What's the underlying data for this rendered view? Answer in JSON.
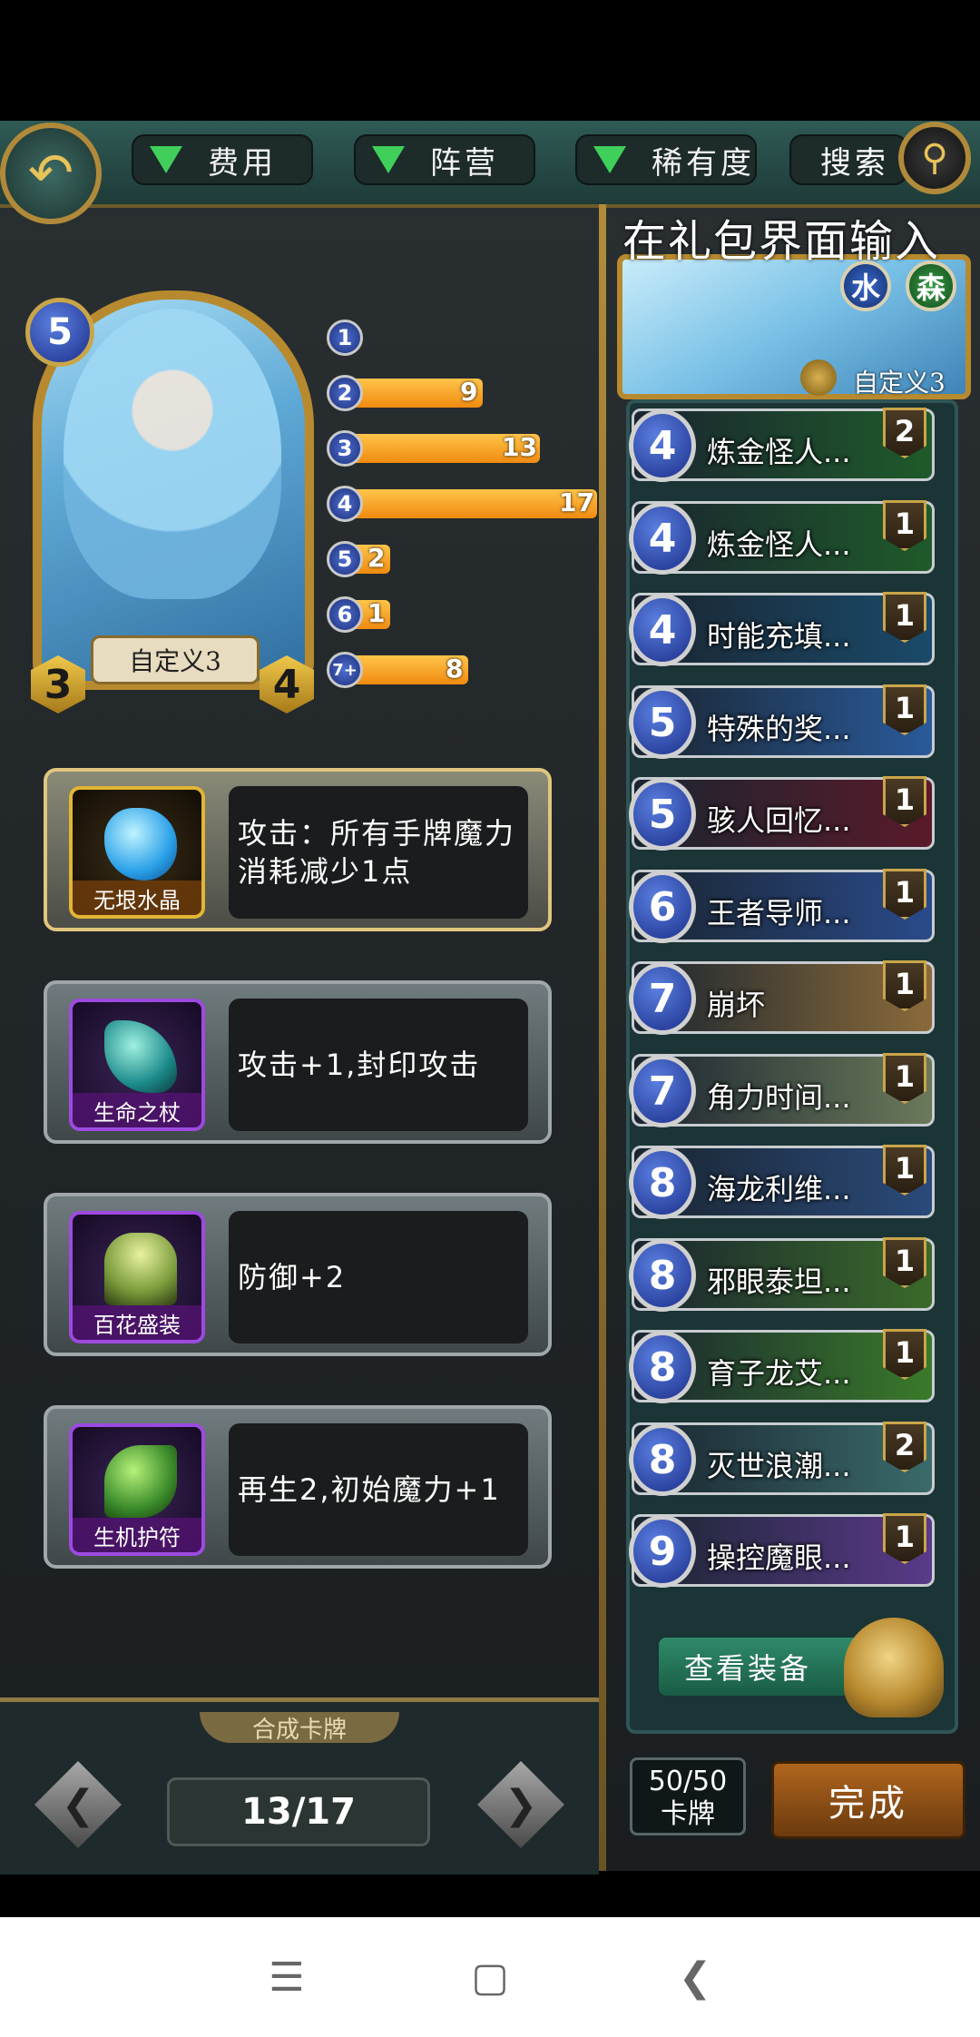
{
  "top_bar": {
    "filters": [
      "费用",
      "阵营",
      "稀有度"
    ],
    "search_label": "搜索"
  },
  "hero": {
    "mana": "5",
    "name": "自定义3",
    "attack": "3",
    "health": "4"
  },
  "mana_curve": [
    {
      "cost": "1",
      "count": ""
    },
    {
      "cost": "2",
      "count": "9"
    },
    {
      "cost": "3",
      "count": "13"
    },
    {
      "cost": "4",
      "count": "17"
    },
    {
      "cost": "5",
      "count": "2"
    },
    {
      "cost": "6",
      "count": "1"
    },
    {
      "cost": "7+",
      "count": "8"
    }
  ],
  "equipment": [
    {
      "name": "无垠水晶",
      "desc": "攻击：所有手牌魔力消耗减少1点"
    },
    {
      "name": "生命之杖",
      "desc": "攻击+1,封印攻击"
    },
    {
      "name": "百花盛装",
      "desc": "防御+2"
    },
    {
      "name": "生机护符",
      "desc": "再生2,初始魔力+1"
    }
  ],
  "synthesis": {
    "label": "合成卡牌",
    "page": "13/17"
  },
  "deck": {
    "tip": "在礼包界面输入",
    "factions": [
      "水",
      "森"
    ],
    "hero_name": "自定义3",
    "cards": [
      {
        "cost": "4",
        "name": "炼金怪人...",
        "qty": "2"
      },
      {
        "cost": "4",
        "name": "炼金怪人...",
        "qty": "1"
      },
      {
        "cost": "4",
        "name": "时能充填...",
        "qty": "1"
      },
      {
        "cost": "5",
        "name": "特殊的奖...",
        "qty": "1"
      },
      {
        "cost": "5",
        "name": "骇人回忆...",
        "qty": "1"
      },
      {
        "cost": "6",
        "name": "王者导师...",
        "qty": "1"
      },
      {
        "cost": "7",
        "name": "崩坏",
        "qty": "1"
      },
      {
        "cost": "7",
        "name": "角力时间...",
        "qty": "1"
      },
      {
        "cost": "8",
        "name": "海龙利维...",
        "qty": "1"
      },
      {
        "cost": "8",
        "name": "邪眼泰坦...",
        "qty": "1"
      },
      {
        "cost": "8",
        "name": "育子龙艾...",
        "qty": "1"
      },
      {
        "cost": "8",
        "name": "灭世浪潮...",
        "qty": "2"
      },
      {
        "cost": "9",
        "name": "操控魔眼...",
        "qty": "1"
      }
    ],
    "view_equipment": "查看装备",
    "count_top": "50/50",
    "count_bottom": "卡牌",
    "done": "完成"
  },
  "colors": {
    "accent_gold": "#b88a2f",
    "bar_orange": "#f08a10",
    "mana_blue": "#1c2f8a"
  }
}
